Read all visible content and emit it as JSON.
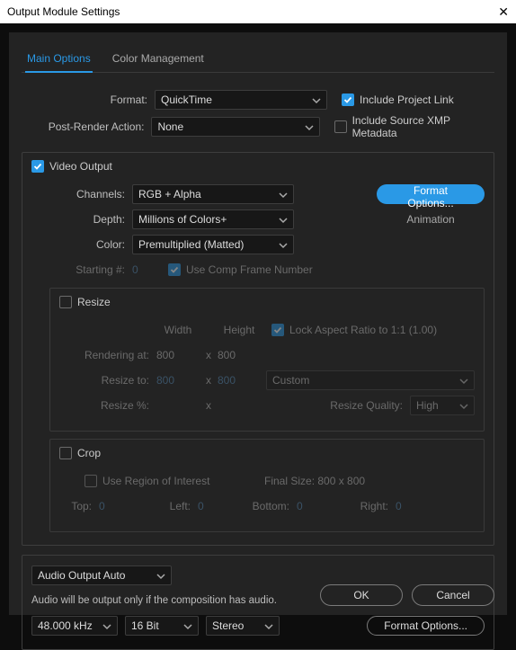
{
  "window": {
    "title": "Output Module Settings"
  },
  "tabs": {
    "main": "Main Options",
    "color": "Color Management"
  },
  "top": {
    "format_label": "Format:",
    "format_value": "QuickTime",
    "post_label": "Post-Render Action:",
    "post_value": "None",
    "include_link": "Include Project Link",
    "include_xmp": "Include Source XMP Metadata"
  },
  "video": {
    "header": "Video Output",
    "channels_label": "Channels:",
    "channels_value": "RGB + Alpha",
    "depth_label": "Depth:",
    "depth_value": "Millions of Colors+",
    "color_label": "Color:",
    "color_value": "Premultiplied (Matted)",
    "start_label": "Starting #:",
    "start_value": "0",
    "use_comp": "Use Comp Frame Number",
    "format_options": "Format Options...",
    "codec": "Animation"
  },
  "resize": {
    "header": "Resize",
    "width": "Width",
    "height": "Height",
    "lock": "Lock Aspect Ratio to 1:1 (1.00)",
    "rendering_label": "Rendering at:",
    "rw": "800",
    "rh": "800",
    "x": "x",
    "resizeto_label": "Resize to:",
    "tw": "800",
    "th": "800",
    "preset": "Custom",
    "pct_label": "Resize %:",
    "quality_label": "Resize Quality:",
    "quality_value": "High"
  },
  "crop": {
    "header": "Crop",
    "roi": "Use Region of Interest",
    "final": "Final Size: 800 x 800",
    "top_l": "Top:",
    "top_v": "0",
    "left_l": "Left:",
    "left_v": "0",
    "bottom_l": "Bottom:",
    "bottom_v": "0",
    "right_l": "Right:",
    "right_v": "0"
  },
  "audio": {
    "mode": "Audio Output Auto",
    "note": "Audio will be output only if the composition has audio.",
    "rate": "48.000 kHz",
    "depth": "16 Bit",
    "channels": "Stereo",
    "format_options": "Format Options..."
  },
  "buttons": {
    "ok": "OK",
    "cancel": "Cancel"
  }
}
